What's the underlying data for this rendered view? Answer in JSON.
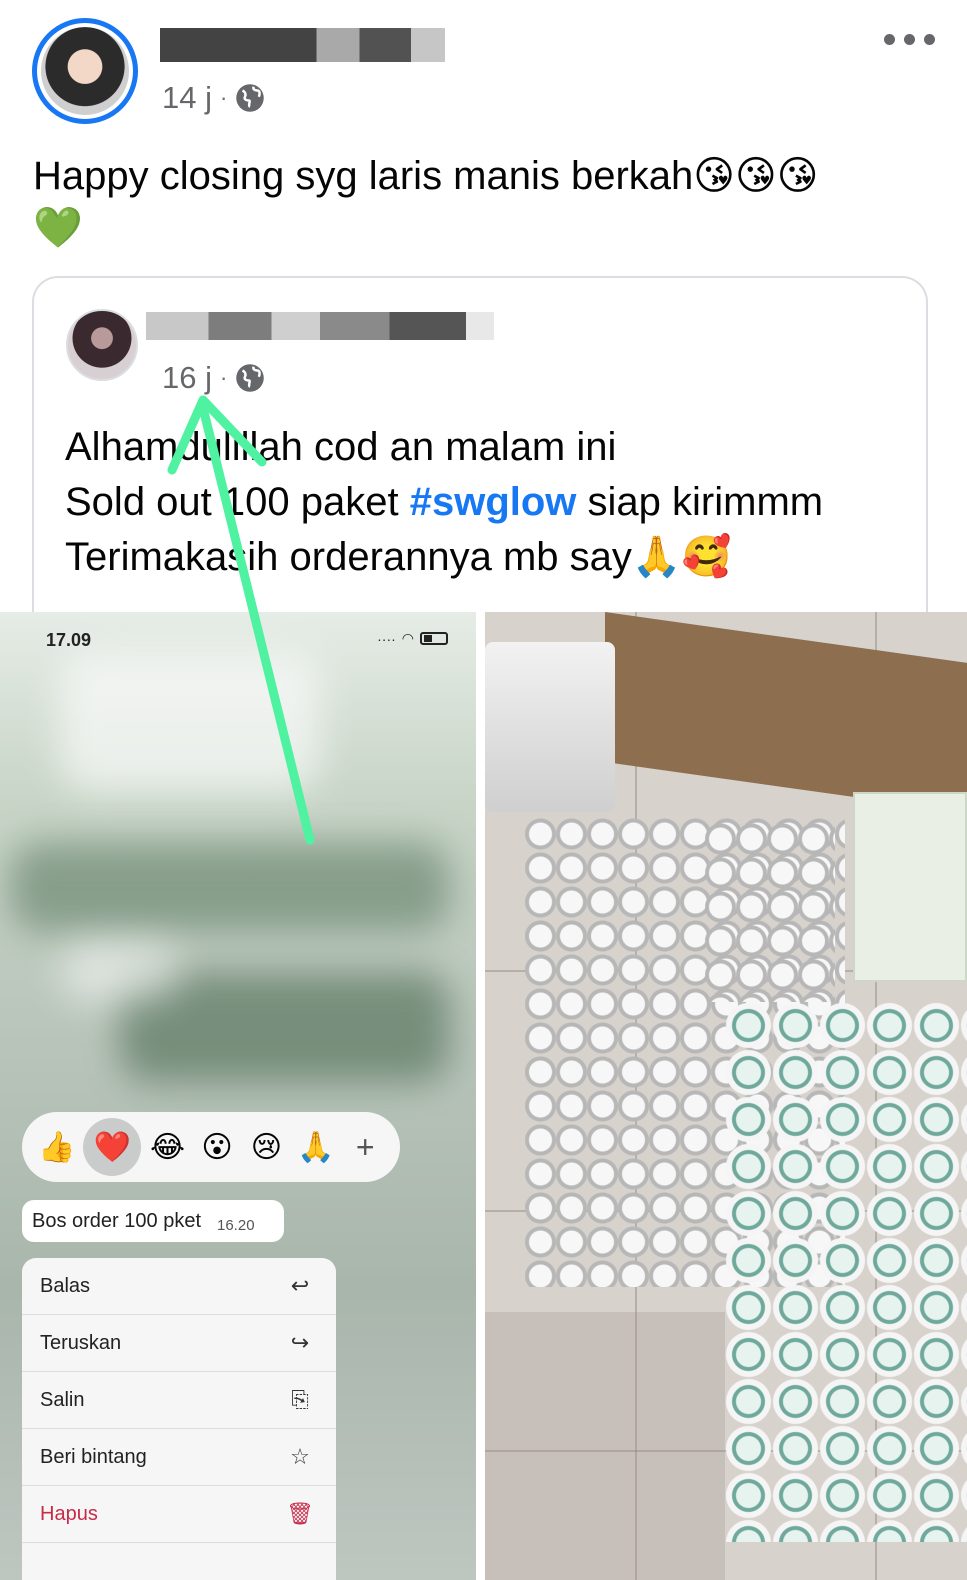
{
  "post": {
    "time": "14 j",
    "separator": "·",
    "text": "Happy closing syg laris manis berkah",
    "emojis": "😘😘😘",
    "emoji_line2": "💚"
  },
  "shared_post": {
    "time": "16 j",
    "separator": "·",
    "line1": "Alhamdulillah cod an malam ini",
    "line2_pre": "Sold out 100 paket ",
    "hashtag": "#swglow",
    "line2_post": " siap kirimmm",
    "line3": "Terimakasih orderannya mb say",
    "line3_emojis": "🙏🥰"
  },
  "chat_screenshot": {
    "status_time": "17.09",
    "reactions": [
      "👍",
      "❤️",
      "😂",
      "😮",
      "😢",
      "🙏",
      "+"
    ],
    "message": {
      "text": "Bos order 100 pket",
      "time": "16.20"
    },
    "menu": [
      {
        "label": "Balas",
        "icon": "reply-icon",
        "glyph": "↩"
      },
      {
        "label": "Teruskan",
        "icon": "forward-icon",
        "glyph": "↪"
      },
      {
        "label": "Salin",
        "icon": "copy-icon",
        "glyph": "⎘"
      },
      {
        "label": "Beri bintang",
        "icon": "star-icon",
        "glyph": "☆"
      },
      {
        "label": "Hapus",
        "icon": "trash-icon",
        "glyph": "🗑"
      }
    ]
  },
  "colors": {
    "link_blue": "#1877f2",
    "annotation_arrow": "#4ef2a0",
    "delete_red": "#c62b4a"
  }
}
